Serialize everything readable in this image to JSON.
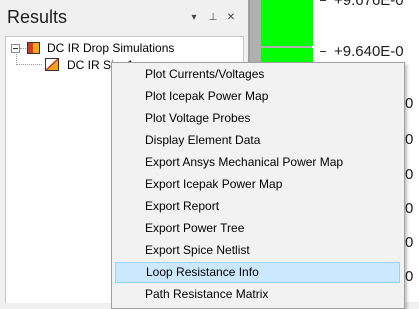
{
  "panel": {
    "title": "Results",
    "buttons": {
      "dropdown": "▾",
      "pin": "⊥",
      "close": "✕"
    }
  },
  "tree": {
    "root_label": "DC IR Drop Simulations",
    "child_label": "DC IR Sim 1"
  },
  "plot": {
    "green_color": "#00ff00",
    "scale_labels": [
      "+9.676E-0",
      "+9.640E-0",
      "-0",
      "-0",
      "-0",
      "-0",
      "-0",
      "-0"
    ]
  },
  "context_menu": {
    "highlight_color": "#cce8ff",
    "items": [
      {
        "label": "Plot Currents/Voltages"
      },
      {
        "label": "Plot Icepak Power Map"
      },
      {
        "label": "Plot Voltage Probes"
      },
      {
        "label": "Display Element Data"
      },
      {
        "label": "Export Ansys Mechanical Power Map"
      },
      {
        "label": "Export Icepak Power Map"
      },
      {
        "label": "Export Report"
      },
      {
        "label": "Export Power Tree"
      },
      {
        "label": "Export Spice Netlist"
      },
      {
        "label": "Loop Resistance Info",
        "highlighted": true
      },
      {
        "label": "Path Resistance Matrix"
      }
    ]
  }
}
